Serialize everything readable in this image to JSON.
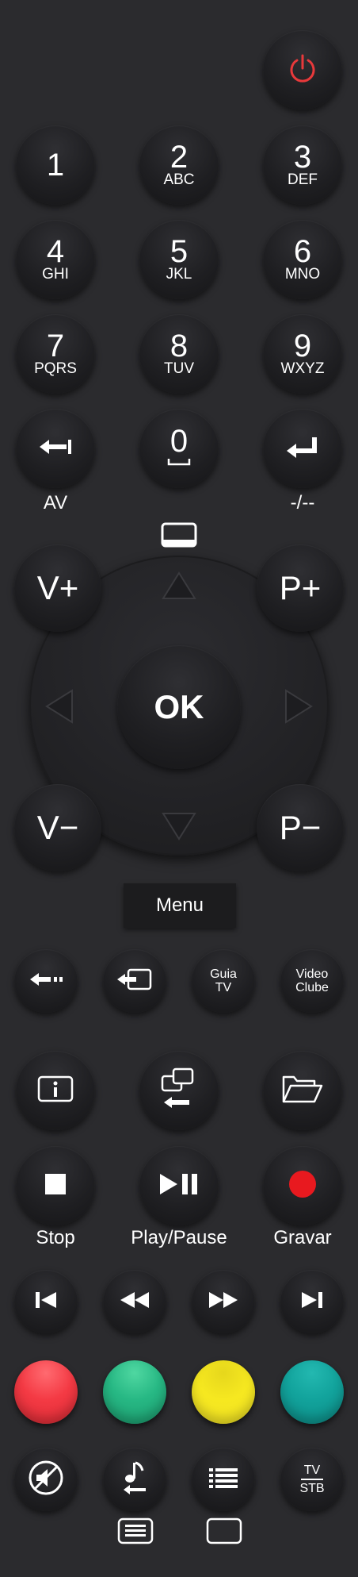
{
  "power": {
    "icon": "power-icon",
    "color": "#e8393b"
  },
  "numpad": [
    {
      "digit": "1",
      "letters": ""
    },
    {
      "digit": "2",
      "letters": "ABC"
    },
    {
      "digit": "3",
      "letters": "DEF"
    },
    {
      "digit": "4",
      "letters": "GHI"
    },
    {
      "digit": "5",
      "letters": "JKL"
    },
    {
      "digit": "6",
      "letters": "MNO"
    },
    {
      "digit": "7",
      "letters": "PQRS"
    },
    {
      "digit": "8",
      "letters": "TUV"
    },
    {
      "digit": "9",
      "letters": "WXYZ"
    }
  ],
  "row4": {
    "av_label": "AV",
    "zero_digit": "0",
    "dash_label": "-/--"
  },
  "volume_up": "V+",
  "volume_down": "V−",
  "program_up": "P+",
  "program_down": "P−",
  "ok_label": "OK",
  "menu_label": "Menu",
  "small_row": {
    "guide_line1": "Guia",
    "guide_line2": "TV",
    "video_line1": "Video",
    "video_line2": "Clube"
  },
  "playback": {
    "stop_label": "Stop",
    "playpause_label": "Play/Pause",
    "record_label": "Gravar"
  },
  "colors": {
    "red": "#f43a44",
    "green": "#27b884",
    "yellow": "#f6e820",
    "teal": "#12a39c"
  },
  "tvstb": {
    "line1": "TV",
    "line2": "STB"
  }
}
